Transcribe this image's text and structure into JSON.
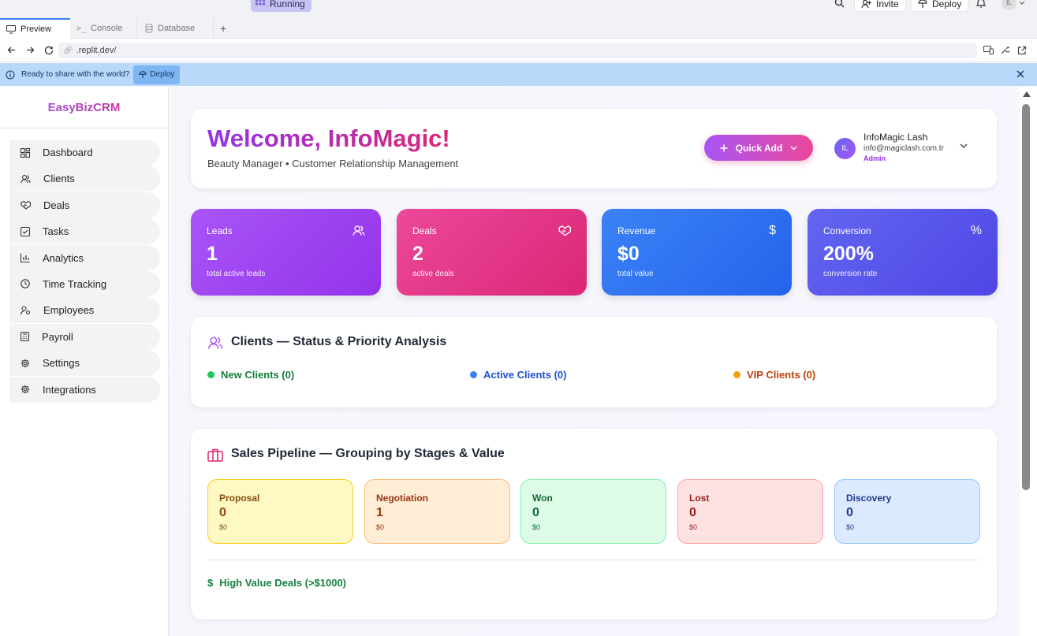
{
  "topbar": {
    "running_label": "Running",
    "invite_label": "Invite",
    "deploy_label": "Deploy",
    "user_initials": "IL"
  },
  "tabs": [
    {
      "label": "Preview"
    },
    {
      "label": "Console"
    },
    {
      "label": "Database"
    }
  ],
  "url": ".replit.dev/",
  "banner": {
    "text": "Ready to share with the world?",
    "deploy_label": "Deploy"
  },
  "sidebar": {
    "brand": "EasyBizCRM",
    "items": [
      {
        "label": "Dashboard",
        "icon": "grid-icon"
      },
      {
        "label": "Clients",
        "icon": "users-icon"
      },
      {
        "label": "Deals",
        "icon": "handshake-icon"
      },
      {
        "label": "Tasks",
        "icon": "checkbox-icon"
      },
      {
        "label": "Analytics",
        "icon": "bar-chart-icon"
      },
      {
        "label": "Time Tracking",
        "icon": "clock-icon"
      },
      {
        "label": "Employees",
        "icon": "user-gear-icon"
      },
      {
        "label": "Payroll",
        "icon": "calculator-icon"
      },
      {
        "label": "Settings",
        "icon": "gear-icon"
      },
      {
        "label": "Integrations",
        "icon": "gear-icon"
      }
    ]
  },
  "header": {
    "title": "Welcome, InfoMagic!",
    "subtitle": "Beauty Manager • Customer Relationship Management",
    "quick_add": "Quick Add",
    "user": {
      "initials": "IL",
      "name": "InfoMagic Lash",
      "email": "info@magiclash.com.tr",
      "role": "Admin"
    }
  },
  "stats": [
    {
      "label": "Leads",
      "value": "1",
      "sub": "total active leads"
    },
    {
      "label": "Deals",
      "value": "2",
      "sub": "active deals"
    },
    {
      "label": "Revenue",
      "value": "$0",
      "sub": "total value"
    },
    {
      "label": "Conversion",
      "value": "200%",
      "sub": "conversion rate"
    }
  ],
  "clients_section": {
    "title": "Clients — Status & Priority Analysis",
    "legend": [
      {
        "label": "New Clients (0)",
        "color": "#16a34a"
      },
      {
        "label": "Active Clients (0)",
        "color": "#2563eb"
      },
      {
        "label": "VIP Clients (0)",
        "color": "#d97706"
      }
    ]
  },
  "pipeline": {
    "title": "Sales Pipeline — Grouping by Stages & Value",
    "stages": [
      {
        "name": "Proposal",
        "count": "0",
        "value": "$0"
      },
      {
        "name": "Negotiation",
        "count": "1",
        "value": "$0"
      },
      {
        "name": "Won",
        "count": "0",
        "value": "$0"
      },
      {
        "name": "Lost",
        "count": "0",
        "value": "$0"
      },
      {
        "name": "Discovery",
        "count": "0",
        "value": "$0"
      }
    ],
    "high_value": "High Value Deals (>$1000)"
  },
  "colors": {
    "accent_purple": "#9333ea",
    "accent_pink": "#db2777",
    "blue": "#2563eb",
    "indigo": "#4f46e5"
  }
}
